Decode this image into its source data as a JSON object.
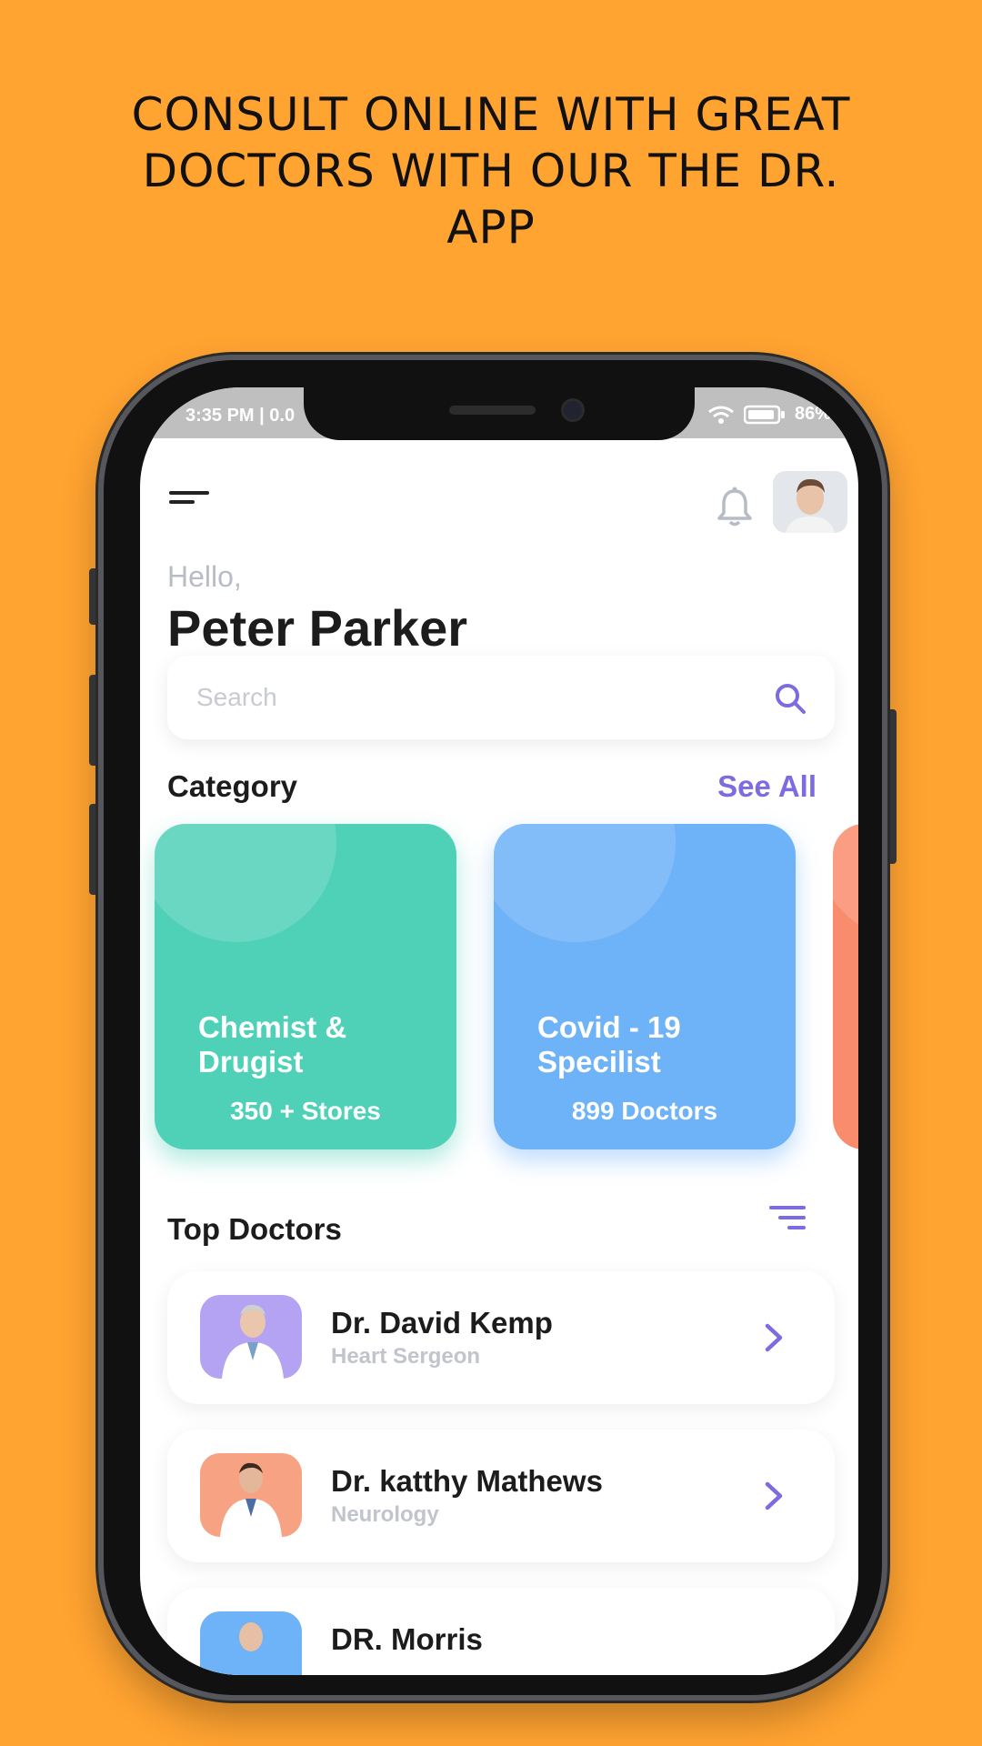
{
  "headline": {
    "line1": "CONSULT ONLINE WITH GREAT",
    "line2": "DOCTORS WITH OUR THE DR.",
    "line3": "APP"
  },
  "status_bar": {
    "time": "3:35 PM | 0.0",
    "battery": "86%"
  },
  "greeting": {
    "hello": "Hello,",
    "name": "Peter Parker"
  },
  "search": {
    "placeholder": "Search"
  },
  "category": {
    "title": "Category",
    "see_all": "See All",
    "items": [
      {
        "title": "Chemist & Drugist",
        "subtitle": "350 + Stores",
        "color": "#4FD1B8"
      },
      {
        "title": "Covid - 19 Specilist",
        "subtitle": "899 Doctors",
        "color": "#6EB2F8"
      },
      {
        "title": "",
        "subtitle": "",
        "color": "#F98C6D"
      }
    ]
  },
  "top_doctors": {
    "title": "Top Doctors",
    "items": [
      {
        "name": "Dr. David Kemp",
        "specialty": "Heart Sergeon",
        "photo_bg": "#B3A3F2"
      },
      {
        "name": "Dr. katthy Mathews",
        "specialty": "Neurology",
        "photo_bg": "#F7A283"
      },
      {
        "name": "DR. Morris",
        "specialty": "",
        "photo_bg": "#6EB2F8"
      }
    ]
  },
  "colors": {
    "background": "#FFA331",
    "accent": "#7B6CE0"
  }
}
